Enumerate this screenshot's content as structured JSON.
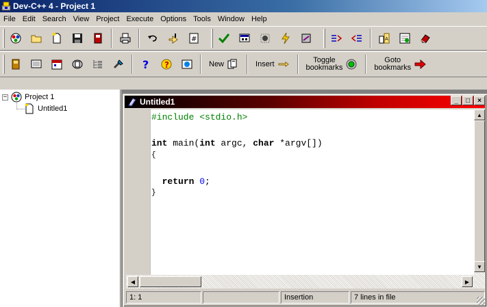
{
  "window": {
    "title": "Dev-C++ 4 - Project 1",
    "app_icon": "devcpp-icon"
  },
  "menu": [
    "File",
    "Edit",
    "Search",
    "View",
    "Project",
    "Execute",
    "Options",
    "Tools",
    "Window",
    "Help"
  ],
  "toolbar1": {
    "groups": [
      [
        "project-icon",
        "open-folder-icon",
        "new-file-icon",
        "save-icon",
        "close-file-icon",
        "print-icon",
        "undo-icon",
        "find-icon",
        "goto-line-icon"
      ],
      [
        "check-compile-icon",
        "run-icon",
        "debug-icon",
        "rebuild-icon",
        "clean-icon"
      ],
      [
        "indent-icon",
        "unindent-icon",
        "find-in-files-icon",
        "options-icon",
        "eraser-icon"
      ]
    ]
  },
  "toolbar2": {
    "icons_a": [
      "plugin-icon",
      "tip-icon",
      "calendar-icon",
      "resource-icon",
      "class-browser-icon",
      "tools-icon"
    ],
    "icons_b": [
      "help-icon",
      "about-icon",
      "web-icon"
    ],
    "text_buttons": {
      "new": "New",
      "insert": "Insert",
      "toggle_line1": "Toggle",
      "toggle_line2": "bookmarks",
      "goto_line1": "Goto",
      "goto_line2": "bookmarks"
    }
  },
  "tree": {
    "root_expander": "−",
    "root": "Project 1",
    "children": [
      "Untitled1"
    ]
  },
  "editor": {
    "title": "Untitled1",
    "title_buttons": [
      "_",
      "□",
      "×"
    ],
    "code": {
      "line1": "#include <stdio.h>",
      "line3_kw1": "int",
      "line3_a": " main(",
      "line3_kw2": "int",
      "line3_b": " argc, ",
      "line3_kw3": "char",
      "line3_c": " *argv[])",
      "line4": "{",
      "line6_kw": "return",
      "line6_num": "0",
      "line6_end": ";",
      "line7": "}"
    }
  },
  "status": {
    "position": "1: 1",
    "modified": "",
    "mode": "Insertion",
    "lines": "7 lines in file"
  }
}
